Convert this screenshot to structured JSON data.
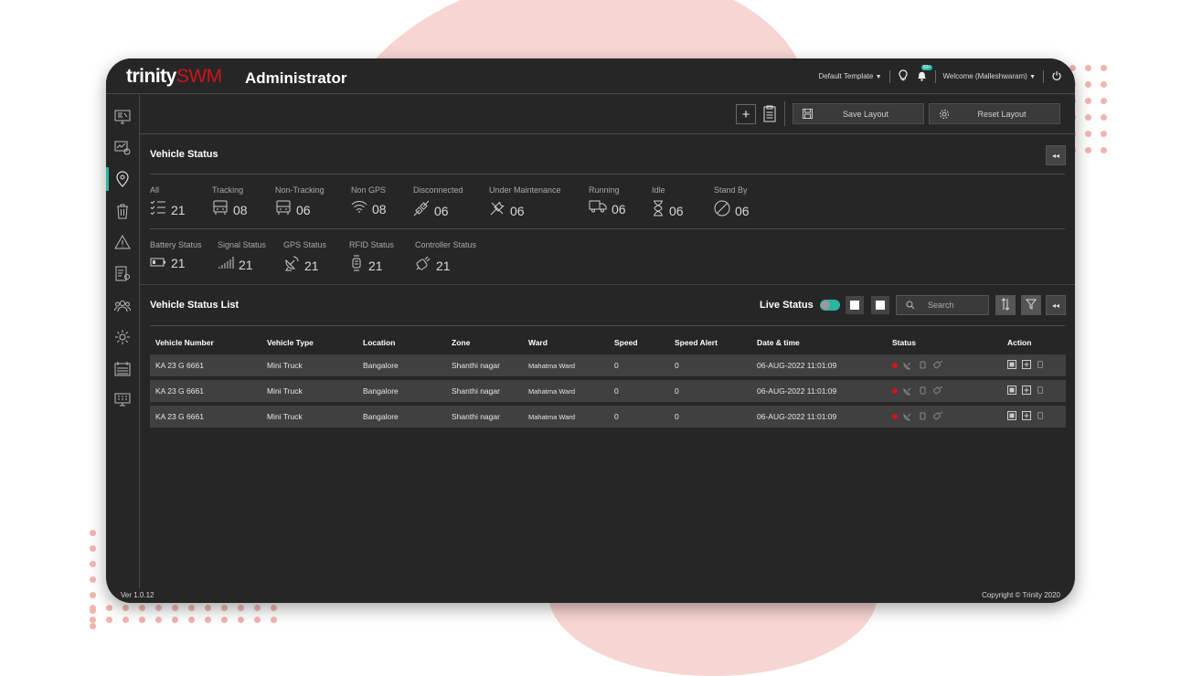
{
  "app": {
    "logo_prefix": "trinity",
    "logo_brand": "SWM",
    "title": "Administrator",
    "template_select": "Default Template",
    "notification_badge": "99+",
    "welcome": "Welcome (Malleshwaram)",
    "version": "Ver 1.0.12",
    "copyright": "Copyright © Trinity 2020",
    "accent_color": "#2bb5a0",
    "brand_color": "#d0141c"
  },
  "sidebar": {
    "items": [
      {
        "icon": "dashboard-icon"
      },
      {
        "icon": "reports-icon"
      },
      {
        "icon": "location-pin-icon",
        "active": true
      },
      {
        "icon": "trash-bin-icon"
      },
      {
        "icon": "alert-icon"
      },
      {
        "icon": "document-user-icon"
      },
      {
        "icon": "users-group-icon"
      },
      {
        "icon": "settings-gear-icon"
      },
      {
        "icon": "calendar-list-icon"
      },
      {
        "icon": "screen-grid-icon"
      }
    ]
  },
  "toolbar": {
    "save_label": "Save Layout",
    "reset_label": "Reset Layout"
  },
  "vehicle_status": {
    "title": "Vehicle Status",
    "stats": [
      {
        "label": "All",
        "value": "21",
        "icon": "checklist-icon"
      },
      {
        "label": "Tracking",
        "value": "08",
        "icon": "truck-front-icon"
      },
      {
        "label": "Non-Tracking",
        "value": "06",
        "icon": "truck-front-icon"
      },
      {
        "label": "Non GPS",
        "value": "08",
        "icon": "wifi-icon"
      },
      {
        "label": "Disconnected",
        "value": "06",
        "icon": "unplugged-icon"
      },
      {
        "label": "Under Maintenance",
        "value": "06",
        "icon": "maintenance-tools-icon"
      },
      {
        "label": "Running",
        "value": "06",
        "icon": "truck-side-icon"
      },
      {
        "label": "Idle",
        "value": "06",
        "icon": "hourglass-icon"
      },
      {
        "label": "Stand By",
        "value": "06",
        "icon": "no-entry-icon"
      }
    ],
    "device_stats": [
      {
        "label": "Battery Status",
        "value": "21",
        "icon": "battery-icon"
      },
      {
        "label": "Signal Status",
        "value": "21",
        "icon": "signal-bars-icon"
      },
      {
        "label": "GPS Status",
        "value": "21",
        "icon": "satellite-dish-icon"
      },
      {
        "label": "RFID Status",
        "value": "21",
        "icon": "rfid-tag-icon"
      },
      {
        "label": "Controller Status",
        "value": "21",
        "icon": "controller-icon"
      }
    ]
  },
  "vehicle_list": {
    "title": "Vehicle Status List",
    "live_status_label": "Live Status",
    "search_placeholder": "Search",
    "columns": [
      "Vehicle Number",
      "Vehicle Type",
      "Location",
      "Zone",
      "Ward",
      "Speed",
      "Speed Alert",
      "Date & time",
      "Status",
      "Action"
    ],
    "rows": [
      [
        "KA 23 G 6661",
        "Mini Truck",
        "Bangalore",
        "Shanthi nagar",
        "Mahatma Ward",
        "0",
        "0",
        "06-AUG-2022 11:01:09"
      ],
      [
        "KA 23 G 6661",
        "Mini Truck",
        "Bangalore",
        "Shanthi nagar",
        "Mahatma Ward",
        "0",
        "0",
        "06-AUG-2022 11:01:09"
      ],
      [
        "KA 23 G 6661",
        "Mini Truck",
        "Bangalore",
        "Shanthi nagar",
        "Mahatma Ward",
        "0",
        "0",
        "06-AUG-2022 11:01:09"
      ]
    ]
  }
}
